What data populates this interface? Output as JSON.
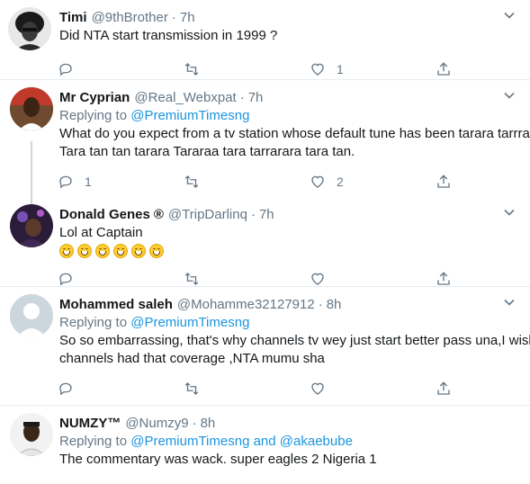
{
  "tweets": [
    {
      "name": "Timi",
      "handle": "@9thBrother",
      "time": "7h",
      "text": "Did NTA start transmission in 1999 ?",
      "replies": "",
      "likes": "1"
    },
    {
      "name": "Mr Cyprian",
      "handle": "@Real_Webxpat",
      "time": "7h",
      "replying_label": "Replying to",
      "replying_to": "@PremiumTimesng",
      "text": "What do you expect from a tv station whose default tune has been tarara tarrra ta Tara tan tan tarara Tararaa tara tarrarara tara tan.",
      "replies": "1",
      "likes": "2"
    },
    {
      "name": "Donald Genes",
      "name_badge": "®",
      "handle": "@TripDarlinq",
      "time": "7h",
      "text": "Lol at Captain",
      "emoji_count": 6,
      "replies": "",
      "likes": ""
    },
    {
      "name": "Mohammed saleh",
      "handle": "@Mohamme32127912",
      "time": "8h",
      "replying_label": "Replying to",
      "replying_to": "@PremiumTimesng",
      "text": "So so embarrassing, that's why channels tv wey just start better pass una,I wish channels had that coverage ,NTA mumu  sha",
      "replies": "",
      "likes": ""
    },
    {
      "name": "NUMZY™",
      "handle": "@Numzy9",
      "time": "8h",
      "replying_label": "Replying to",
      "replying_to": "@PremiumTimesng",
      "replying_and": "and",
      "replying_to_2": "@akaebube",
      "text": "The commentary was wack. super eagles 2 Nigeria 1"
    }
  ],
  "colors": {
    "link": "#1b95e0",
    "secondary": "#657786",
    "divider": "#e6ecf0"
  },
  "dot": "·"
}
